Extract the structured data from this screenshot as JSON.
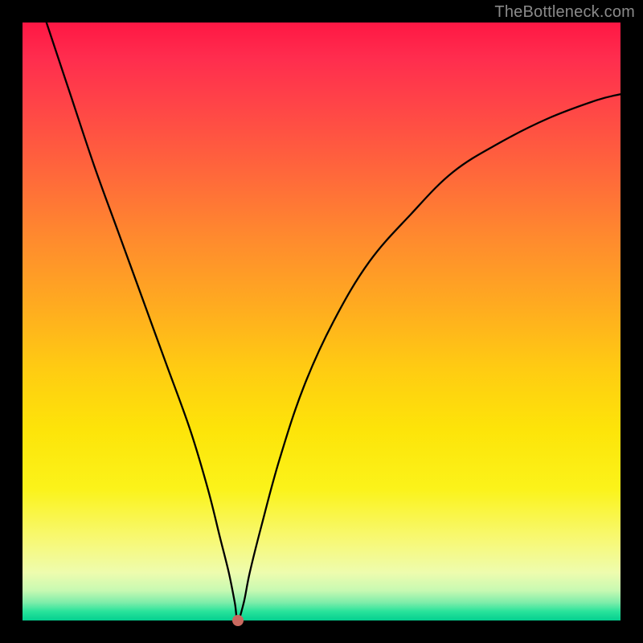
{
  "watermark": "TheBottleneck.com",
  "chart_data": {
    "type": "line",
    "title": "",
    "xlabel": "",
    "ylabel": "",
    "xlim": [
      0,
      100
    ],
    "ylim": [
      0,
      100
    ],
    "grid": false,
    "series": [
      {
        "name": "curve",
        "x": [
          4,
          8,
          12,
          16,
          20,
          24,
          28,
          31,
          33,
          34.5,
          35.5,
          36,
          37,
          38,
          40,
          43,
          47,
          52,
          58,
          65,
          72,
          80,
          88,
          96,
          100
        ],
        "y": [
          100,
          88,
          76,
          65,
          54,
          43,
          32,
          22,
          14,
          8,
          3,
          0,
          3,
          8,
          16,
          27,
          39,
          50,
          60,
          68,
          75,
          80,
          84,
          87,
          88
        ]
      }
    ],
    "marker": {
      "x": 36,
      "y": 0,
      "color": "#c9695f"
    },
    "gradient_stops": [
      {
        "pos": 0,
        "color": "#ff1744"
      },
      {
        "pos": 0.48,
        "color": "#ffad1f"
      },
      {
        "pos": 0.78,
        "color": "#fbf31a"
      },
      {
        "pos": 1.0,
        "color": "#04cf8f"
      }
    ]
  }
}
